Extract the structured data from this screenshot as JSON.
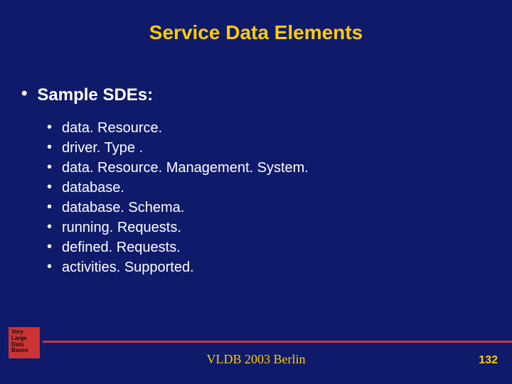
{
  "title": "Service Data Elements",
  "heading": "Sample SDEs:",
  "items": [
    "data. Resource.",
    "driver. Type .",
    "data. Resource. Management. System.",
    "database.",
    "database. Schema.",
    "running. Requests.",
    "defined. Requests.",
    "activities. Supported."
  ],
  "logo": {
    "line1": "Very",
    "line2": "Large",
    "line3": "Data",
    "line4": "Bases"
  },
  "footer": "VLDB 2003 Berlin",
  "page": "132"
}
